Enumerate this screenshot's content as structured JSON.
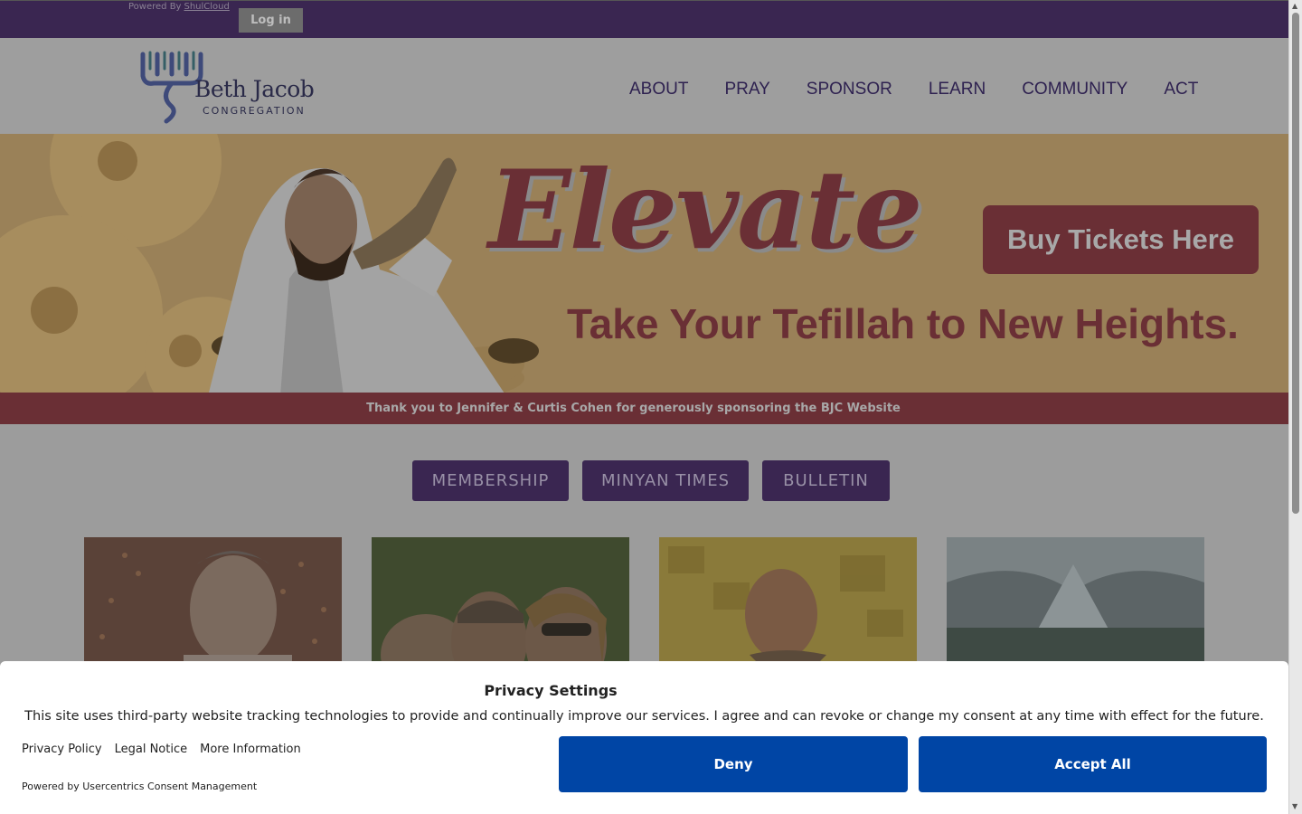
{
  "topbar": {
    "powered_by": "Powered By",
    "powered_link": "ShulCloud",
    "login_label": "Log in"
  },
  "header": {
    "logo_name": "Beth Jacob",
    "logo_sub": "CONGREGATION",
    "nav": [
      "ABOUT",
      "PRAY",
      "SPONSOR",
      "LEARN",
      "COMMUNITY",
      "ACT"
    ]
  },
  "hero": {
    "headline": "Elevate",
    "cta_label": "Buy Tickets Here",
    "tagline": "Take Your Tefillah to New Heights."
  },
  "sponsor_bar": {
    "text": "Thank you to Jennifer & Curtis Cohen for generously sponsoring the BJC Website"
  },
  "quick_links": [
    "MEMBERSHIP",
    "MINYAN TIMES",
    "BULLETIN"
  ],
  "consent": {
    "title": "Privacy Settings",
    "text": "This site uses third-party website tracking technologies to provide and continually improve our services. I agree and can revoke or change my consent at any time with effect for the future.",
    "links": [
      "Privacy Policy",
      "Legal Notice",
      "More Information"
    ],
    "powered": "Powered by Usercentrics Consent Management",
    "deny_label": "Deny",
    "accept_label": "Accept All"
  },
  "colors": {
    "brand_purple": "#3a2651",
    "hero_red": "#6a2f35",
    "consent_blue": "#0045a5"
  }
}
